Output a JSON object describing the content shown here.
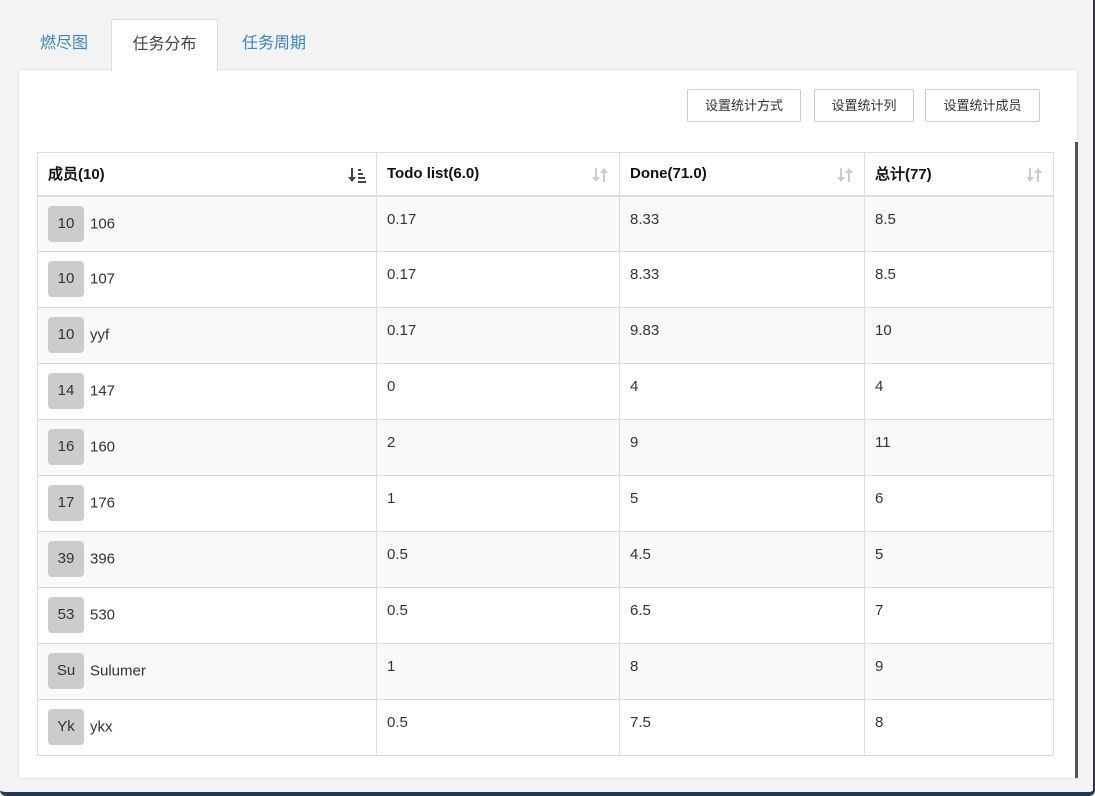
{
  "tabs": [
    {
      "label": "燃尽图",
      "active": false
    },
    {
      "label": "任务分布",
      "active": true
    },
    {
      "label": "任务周期",
      "active": false
    }
  ],
  "toolbar": {
    "btn_method": "设置统计方式",
    "btn_columns": "设置统计列",
    "btn_members": "设置统计成员"
  },
  "table": {
    "headers": [
      "成员(10)",
      "Todo list(6.0)",
      "Done(71.0)",
      "总计(77)"
    ],
    "rows": [
      {
        "avatar": "10",
        "name": "106",
        "todo": "0.17",
        "done": "8.33",
        "total": "8.5"
      },
      {
        "avatar": "10",
        "name": "107",
        "todo": "0.17",
        "done": "8.33",
        "total": "8.5"
      },
      {
        "avatar": "10",
        "name": "yyf",
        "todo": "0.17",
        "done": "9.83",
        "total": "10"
      },
      {
        "avatar": "14",
        "name": "147",
        "todo": "0",
        "done": "4",
        "total": "4"
      },
      {
        "avatar": "16",
        "name": "160",
        "todo": "2",
        "done": "9",
        "total": "11"
      },
      {
        "avatar": "17",
        "name": "176",
        "todo": "1",
        "done": "5",
        "total": "6"
      },
      {
        "avatar": "39",
        "name": "396",
        "todo": "0.5",
        "done": "4.5",
        "total": "5"
      },
      {
        "avatar": "53",
        "name": "530",
        "todo": "0.5",
        "done": "6.5",
        "total": "7"
      },
      {
        "avatar": "Su",
        "name": "Sulumer",
        "todo": "1",
        "done": "8",
        "total": "9"
      },
      {
        "avatar": "Yk",
        "name": "ykx",
        "todo": "0.5",
        "done": "7.5",
        "total": "8"
      }
    ]
  },
  "colors": {
    "tab_link": "#3a87c8",
    "avatar_bg": "#cccccc",
    "row_stripe": "#f9f9f9"
  },
  "icons": {
    "sort_active": "sort-amount-down-icon",
    "sort_inactive": "sort-icon"
  }
}
